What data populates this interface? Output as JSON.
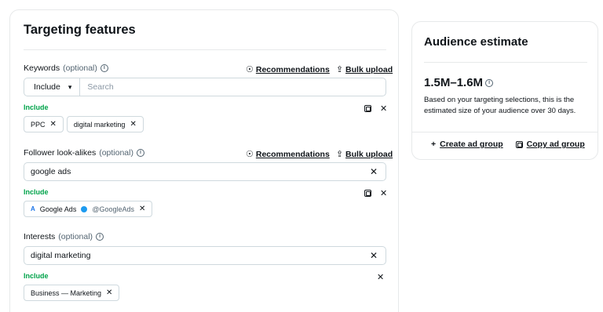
{
  "main": {
    "title": "Targeting features",
    "keywords": {
      "label": "Keywords",
      "optional": "(optional)",
      "recommendations": "Recommendations",
      "bulk_upload": "Bulk upload",
      "select_value": "Include",
      "search_placeholder": "Search",
      "include_label": "Include",
      "chips": [
        "PPC",
        "digital marketing"
      ]
    },
    "lookalikes": {
      "label": "Follower look-alikes",
      "optional": "(optional)",
      "recommendations": "Recommendations",
      "bulk_upload": "Bulk upload",
      "input_value": "google ads",
      "include_label": "Include",
      "chip_name": "Google Ads",
      "chip_handle": "@GoogleAds"
    },
    "interests": {
      "label": "Interests",
      "optional": "(optional)",
      "input_value": "digital marketing",
      "include_label": "Include",
      "chips": [
        "Business — Marketing"
      ]
    }
  },
  "side": {
    "title": "Audience estimate",
    "estimate": "1.5M–1.6M",
    "description": "Based on your targeting selections, this is the estimated size of your audience over 30 days.",
    "create_ad_group": "Create ad group",
    "copy_ad_group": "Copy ad group"
  },
  "icons": {
    "info": "ⓘ",
    "recommend": "☉",
    "upload": "⇪",
    "close": "✕",
    "chevron": "⌄",
    "plus": "+",
    "google_ads_mark": "A"
  },
  "colors": {
    "include_green": "#00a34a",
    "border": "#cfd9de",
    "verified_blue": "#1d9bf0"
  }
}
